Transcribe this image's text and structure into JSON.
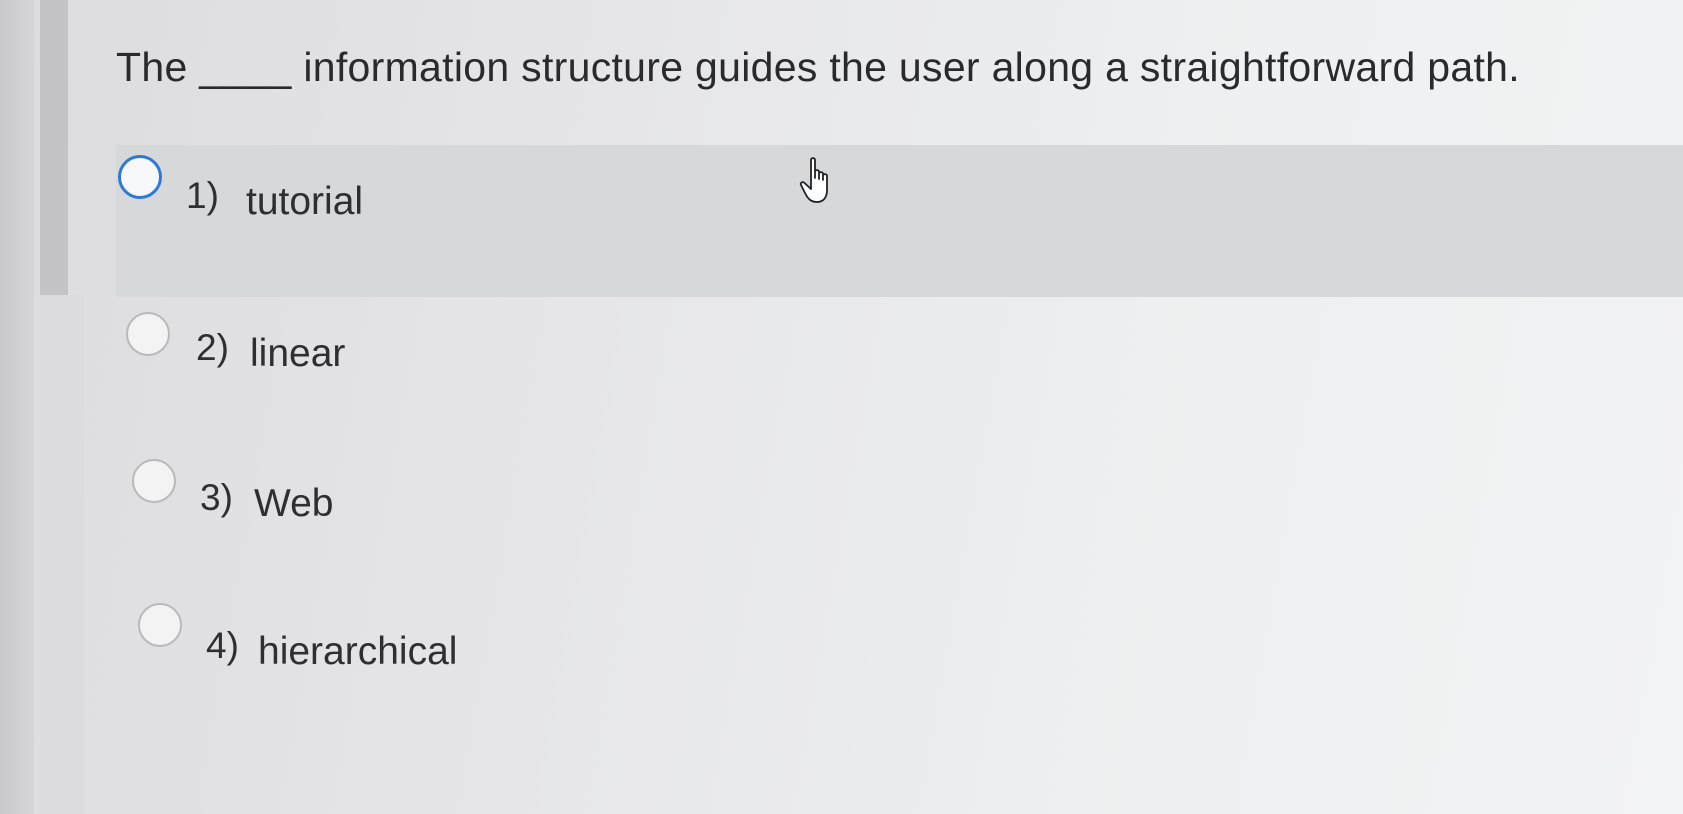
{
  "question": {
    "text": "The ____ information structure guides the user along a straightforward path."
  },
  "answers": [
    {
      "number": "1)",
      "label": "tutorial"
    },
    {
      "number": "2)",
      "label": "linear"
    },
    {
      "number": "3)",
      "label": "Web"
    },
    {
      "number": "4)",
      "label": "hierarchical"
    }
  ],
  "colors": {
    "hover_row": "#d7d8da",
    "radio_focus": "#2c7ad6",
    "text": "#2f2f33"
  },
  "icons": {
    "cursor": "hand-pointer-icon"
  }
}
